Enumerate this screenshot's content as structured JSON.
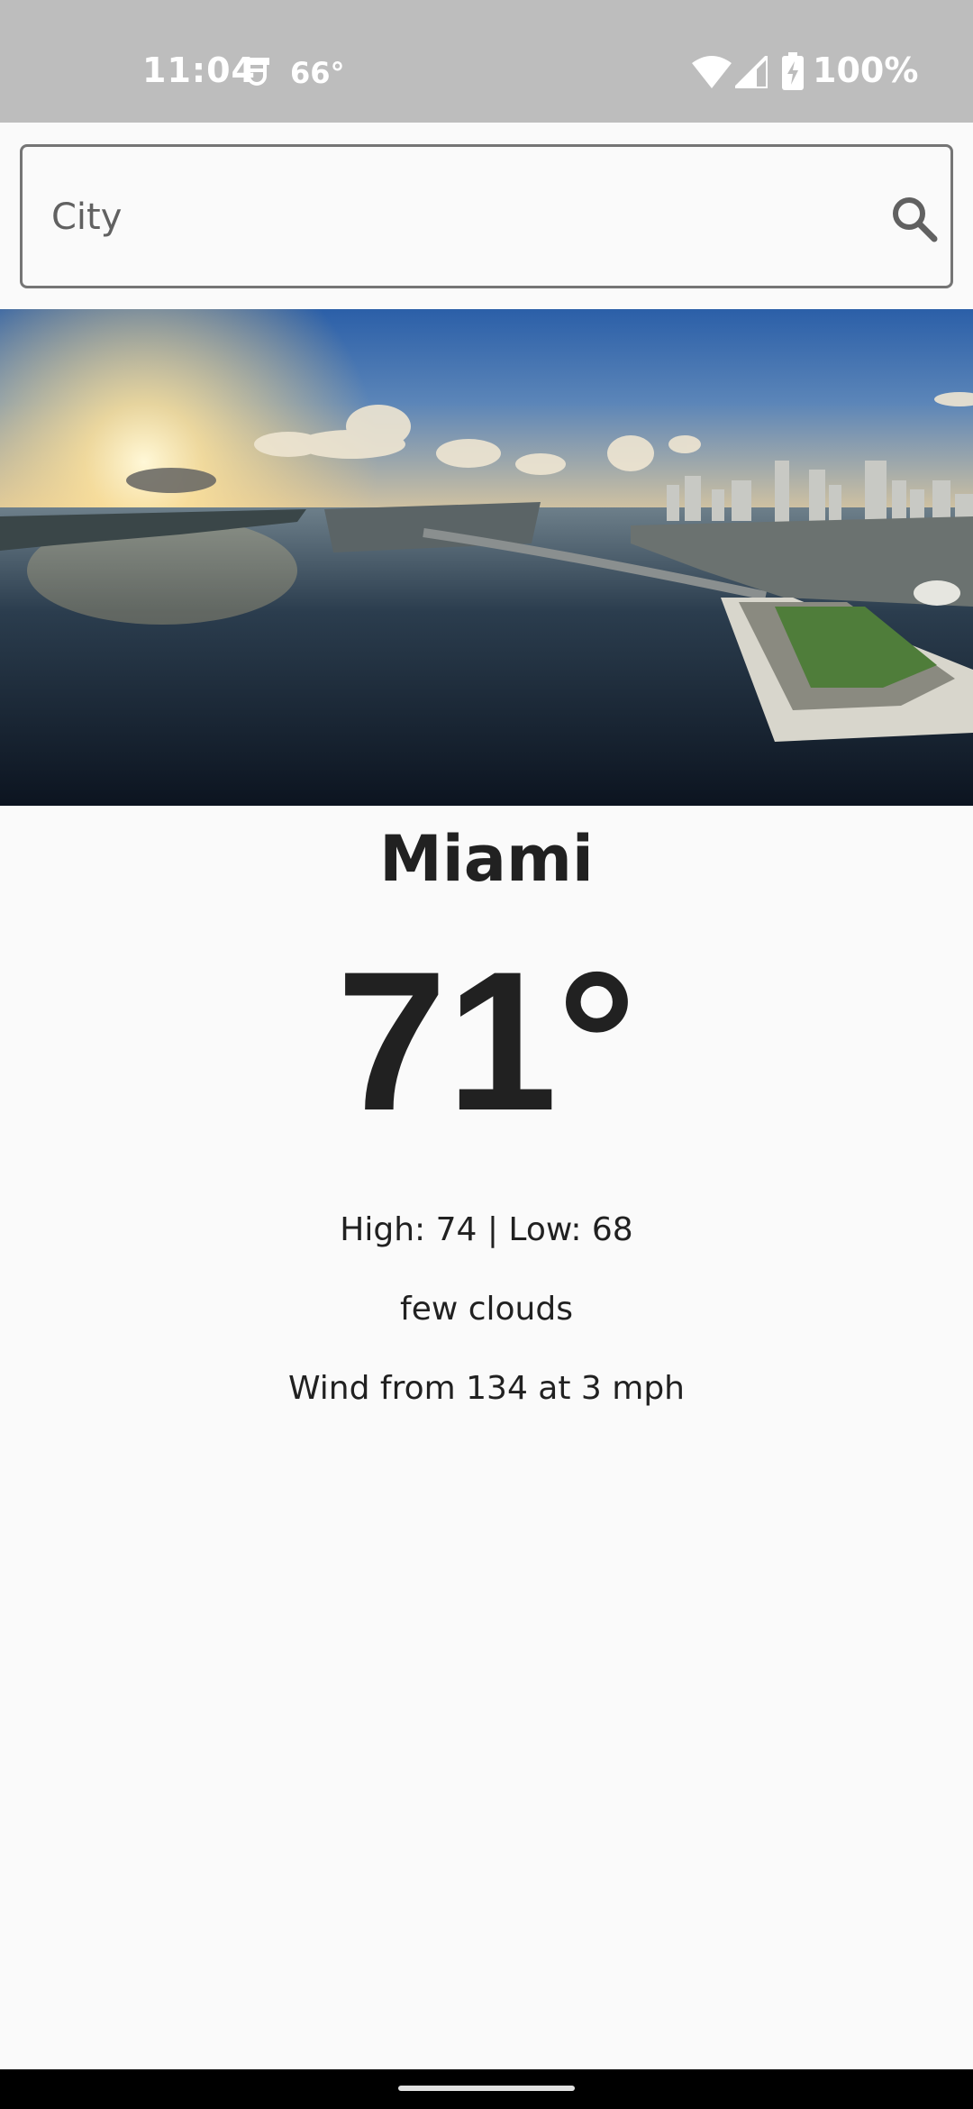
{
  "status_bar": {
    "time": "11:04",
    "temperature": "66°",
    "battery": "100%",
    "icons": [
      "notification-icon",
      "wifi-icon",
      "cell-signal-icon",
      "battery-charging-icon"
    ]
  },
  "search": {
    "placeholder": "City",
    "value": "",
    "icon": "search-icon"
  },
  "hero": {
    "image": "city-skyline-photo"
  },
  "weather": {
    "city": "Miami",
    "temperature": "71°",
    "high_low": "High: 74 | Low: 68",
    "conditions": "few clouds",
    "wind": "Wind from 134 at 3 mph"
  },
  "colors": {
    "status_bar_bg": "#bdbdbd",
    "background": "#fafafa",
    "text": "#212121"
  }
}
